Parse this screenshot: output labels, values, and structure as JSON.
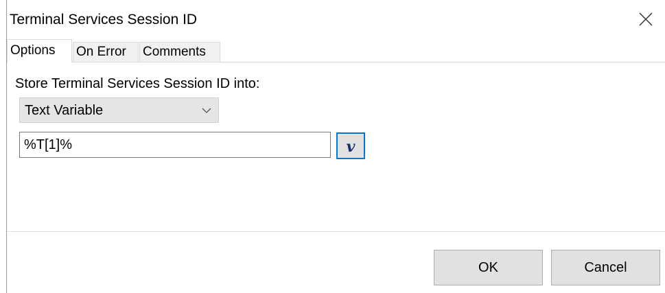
{
  "window": {
    "title": "Terminal Services Session ID"
  },
  "tabs": [
    {
      "label": "Options",
      "active": true
    },
    {
      "label": "On Error",
      "active": false
    },
    {
      "label": "Comments",
      "active": false
    }
  ],
  "options": {
    "store_label": "Store Terminal Services Session ID into:",
    "variable_type": "Text Variable",
    "variable_value": "%T[1]%",
    "variable_button_label": "v"
  },
  "footer": {
    "ok_label": "OK",
    "cancel_label": "Cancel"
  },
  "colors": {
    "focus_border": "#0078d7",
    "button_face": "#e1e1e1",
    "combo_face": "#e5e5e5"
  },
  "icons": {
    "close": "close-icon",
    "dropdown": "chevron-down-icon"
  }
}
